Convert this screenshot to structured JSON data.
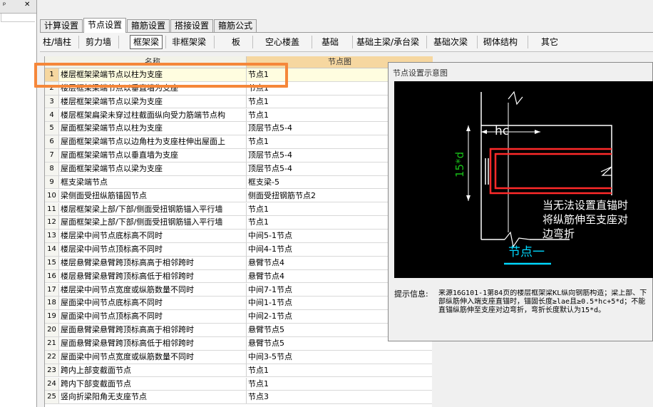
{
  "left_panel": {
    "pin_glyph": "ᵖ",
    "close_glyph": "✕"
  },
  "tabs": [
    "计算设置",
    "节点设置",
    "箍筋设置",
    "搭接设置",
    "箍筋公式"
  ],
  "active_tab": 1,
  "subtabs": [
    "柱/墙柱",
    "剪力墙",
    "框架梁",
    "非框架梁",
    "板",
    "空心楼盖",
    "基础",
    "基础主梁/承台梁",
    "基础次梁",
    "砌体结构",
    "其它"
  ],
  "active_subtab": 2,
  "grid": {
    "col_name": "名称",
    "col_img": "节点图",
    "rows": [
      {
        "num": "1",
        "name": "楼层框架梁端节点以柱为支座",
        "val": "节点1"
      },
      {
        "num": "2",
        "name": "楼层框架梁端节点以垂直墙为支座",
        "val": "节点1"
      },
      {
        "num": "3",
        "name": "楼层框架梁端节点以梁为支座",
        "val": "节点1"
      },
      {
        "num": "4",
        "name": "楼层框架扁梁未穿过柱截面纵向受力筋端节点构",
        "val": "节点1"
      },
      {
        "num": "5",
        "name": "屋面框架梁端节点以柱为支座",
        "val": "顶层节点5-4"
      },
      {
        "num": "6",
        "name": "屋面框架梁端节点以边角柱为支座柱伸出屋面上",
        "val": "节点1"
      },
      {
        "num": "7",
        "name": "屋面框架梁端节点以垂直墙为支座",
        "val": "顶层节点5-4"
      },
      {
        "num": "8",
        "name": "屋面框架梁端节点以梁为支座",
        "val": "顶层节点5-4"
      },
      {
        "num": "9",
        "name": "框支梁端节点",
        "val": "框支梁-5"
      },
      {
        "num": "10",
        "name": "梁侧面受扭纵筋锚固节点",
        "val": "侧面受扭钢筋节点2"
      },
      {
        "num": "11",
        "name": "楼层框架梁上部/下部/侧面受扭钢筋锚入平行墙",
        "val": "节点1"
      },
      {
        "num": "12",
        "name": "屋面框架梁上部/下部/侧面受扭钢筋锚入平行墙",
        "val": "节点1"
      },
      {
        "num": "13",
        "name": "楼层梁中间节点底标高不同时",
        "val": "中间5-1节点"
      },
      {
        "num": "14",
        "name": "楼层梁中间节点顶标高不同时",
        "val": "中间4-1节点"
      },
      {
        "num": "15",
        "name": "楼层悬臂梁悬臂跨顶标高高于相邻跨时",
        "val": "悬臂节点4"
      },
      {
        "num": "16",
        "name": "楼层悬臂梁悬臂跨顶标高低于相邻跨时",
        "val": "悬臂节点4"
      },
      {
        "num": "17",
        "name": "楼层梁中间节点宽度或纵筋数量不同时",
        "val": "中间7-1节点"
      },
      {
        "num": "18",
        "name": "屋面梁中间节点底标高不同时",
        "val": "中间1-1节点"
      },
      {
        "num": "19",
        "name": "屋面梁中间节点顶标高不同时",
        "val": "中间2-1节点"
      },
      {
        "num": "20",
        "name": "屋面悬臂梁悬臂跨顶标高高于相邻跨时",
        "val": "悬臂节点5"
      },
      {
        "num": "21",
        "name": "屋面悬臂梁悬臂跨顶标高低于相邻跨时",
        "val": "悬臂节点5"
      },
      {
        "num": "22",
        "name": "屋面梁中间节点宽度或纵筋数量不同时",
        "val": "中间3-5节点"
      },
      {
        "num": "23",
        "name": "跨内上部变截面节点",
        "val": "节点1"
      },
      {
        "num": "24",
        "name": "跨内下部变截面节点",
        "val": "节点1"
      },
      {
        "num": "25",
        "name": "竖向折梁阳角无支座节点",
        "val": "节点3"
      }
    ]
  },
  "popup": {
    "title": "节点设置示意图",
    "diagram": {
      "dim_hc": "hc",
      "dim_15d": "15*d",
      "note_lines": [
        "当无法设置直锚时",
        "将纵筋伸至支座对",
        "边弯折"
      ],
      "caption": "节点一"
    },
    "info_label": "提示信息:",
    "info_text": "来源16G101-1第84页的楼层框架梁KL纵向钢筋构造；梁上部、下部纵筋伸入端支座直锚时，锚固长度≥lae且≥0.5*hc+5*d；不能直锚纵筋伸至支座对边弯折，弯折长度默认为15*d。"
  },
  "colors": {
    "highlight": "#f5873a",
    "rebar": "#ff2a2a",
    "dim_green": "#18c018",
    "caption_cyan": "#00d8ff",
    "header_orange": "#f6d7a0",
    "selected_row": "#fffde0"
  }
}
